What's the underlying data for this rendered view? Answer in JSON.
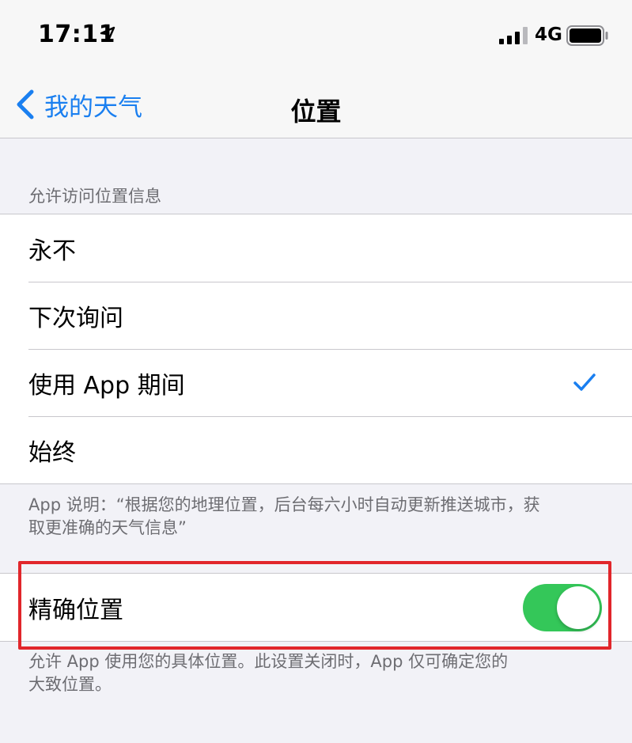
{
  "status_bar": {
    "time": "17:11",
    "network": "4G",
    "icons": [
      "location-arrow-icon",
      "signal-icon",
      "battery-icon"
    ]
  },
  "nav": {
    "back_label": "我的天气",
    "title": "位置"
  },
  "location_access": {
    "header": "允许访问位置信息",
    "options": [
      {
        "label": "永不",
        "selected": false
      },
      {
        "label": "下次询问",
        "selected": false
      },
      {
        "label": "使用 App 期间",
        "selected": true
      },
      {
        "label": "始终",
        "selected": false
      }
    ],
    "footer_line1": "App 说明：“根据您的地理位置，后台每六小时自动更新推送城市，获",
    "footer_line2": "取更准确的天气信息”"
  },
  "precise_location": {
    "label": "精确位置",
    "enabled": true,
    "footer_line1": "允许 App 使用您的具体位置。此设置关闭时，App 仅可确定您的",
    "footer_line2": "大致位置。"
  },
  "colors": {
    "accent": "#1a7ff0",
    "toggle_on": "#34c759",
    "highlight": "#e1262b",
    "background": "#f2f2f7"
  }
}
